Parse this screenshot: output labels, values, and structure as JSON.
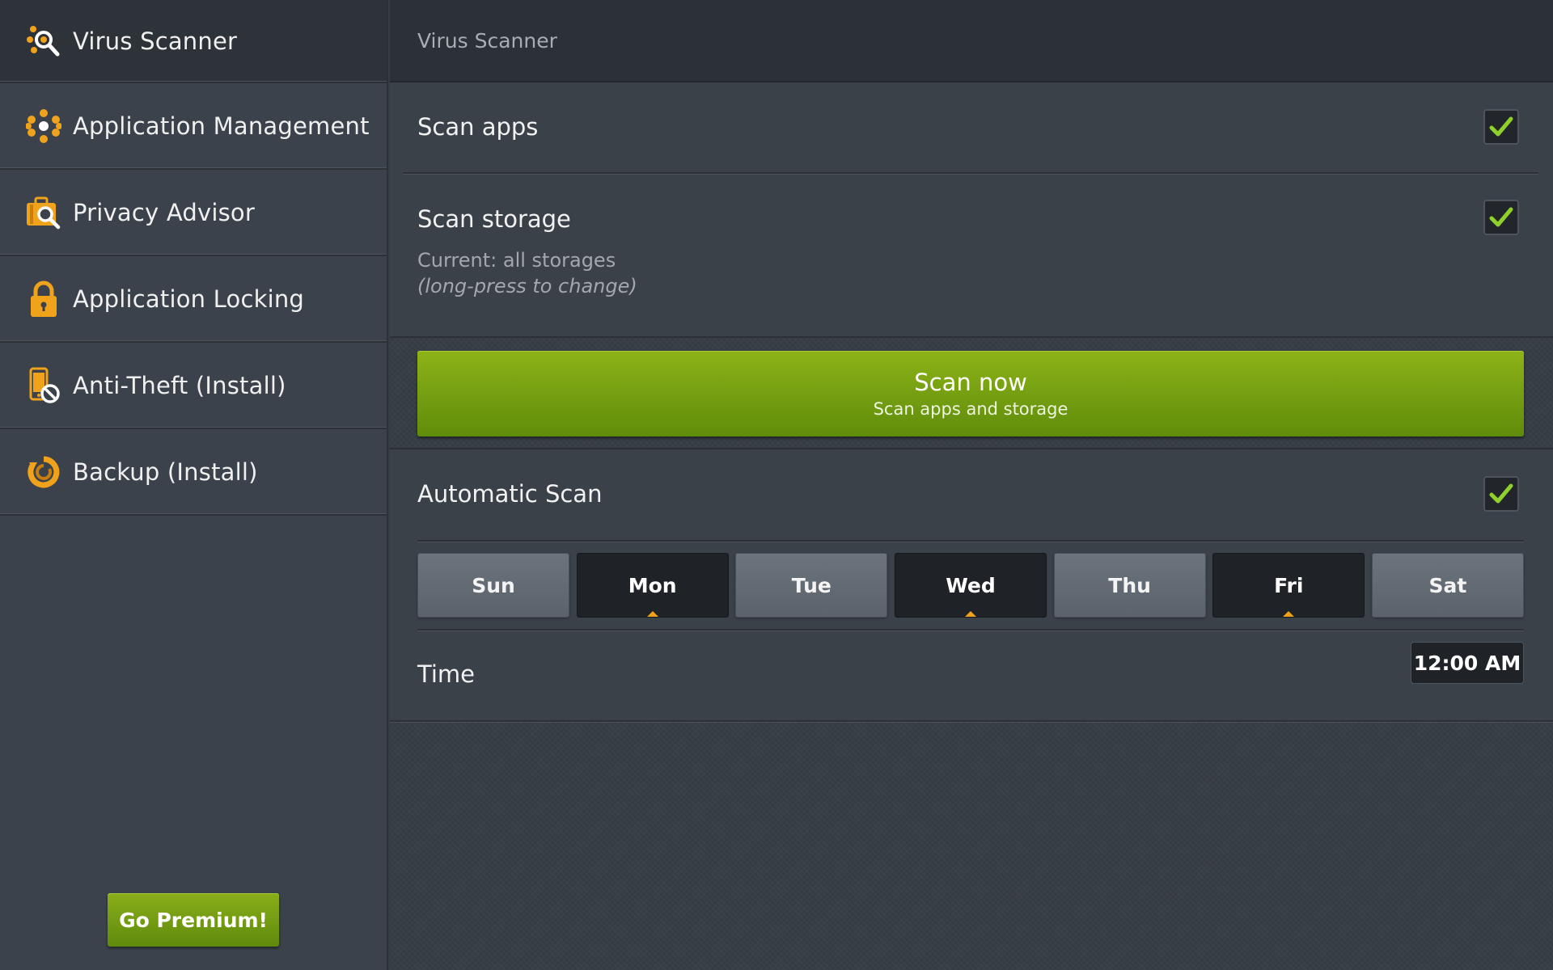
{
  "sidebar": {
    "items": [
      {
        "label": "Virus Scanner",
        "icon": "magnifier-virus-icon",
        "active": true
      },
      {
        "label": "Application Management",
        "icon": "app-management-icon"
      },
      {
        "label": "Privacy Advisor",
        "icon": "briefcase-search-icon"
      },
      {
        "label": "Application Locking",
        "icon": "padlock-icon"
      },
      {
        "label": "Anti-Theft (Install)",
        "icon": "phone-block-icon"
      },
      {
        "label": "Backup (Install)",
        "icon": "backup-ring-icon"
      }
    ],
    "premium_label": "Go Premium!"
  },
  "header": {
    "title": "Virus Scanner"
  },
  "settings": {
    "scan_apps": {
      "label": "Scan apps",
      "checked": true
    },
    "scan_storage": {
      "label": "Scan storage",
      "checked": true,
      "current": "Current: all storages",
      "hint": "(long-press to change)"
    },
    "scan_now": {
      "title": "Scan now",
      "subtitle": "Scan apps and storage"
    },
    "automatic_scan": {
      "label": "Automatic Scan",
      "checked": true
    },
    "days": [
      {
        "label": "Sun",
        "selected": false
      },
      {
        "label": "Mon",
        "selected": true
      },
      {
        "label": "Tue",
        "selected": false
      },
      {
        "label": "Wed",
        "selected": true
      },
      {
        "label": "Thu",
        "selected": false
      },
      {
        "label": "Fri",
        "selected": true
      },
      {
        "label": "Sat",
        "selected": false
      }
    ],
    "time": {
      "label": "Time",
      "value": "12:00 AM"
    }
  },
  "colors": {
    "accent_orange": "#f0a21a",
    "accent_green": "#7fa812",
    "check_green": "#8fd12a"
  }
}
